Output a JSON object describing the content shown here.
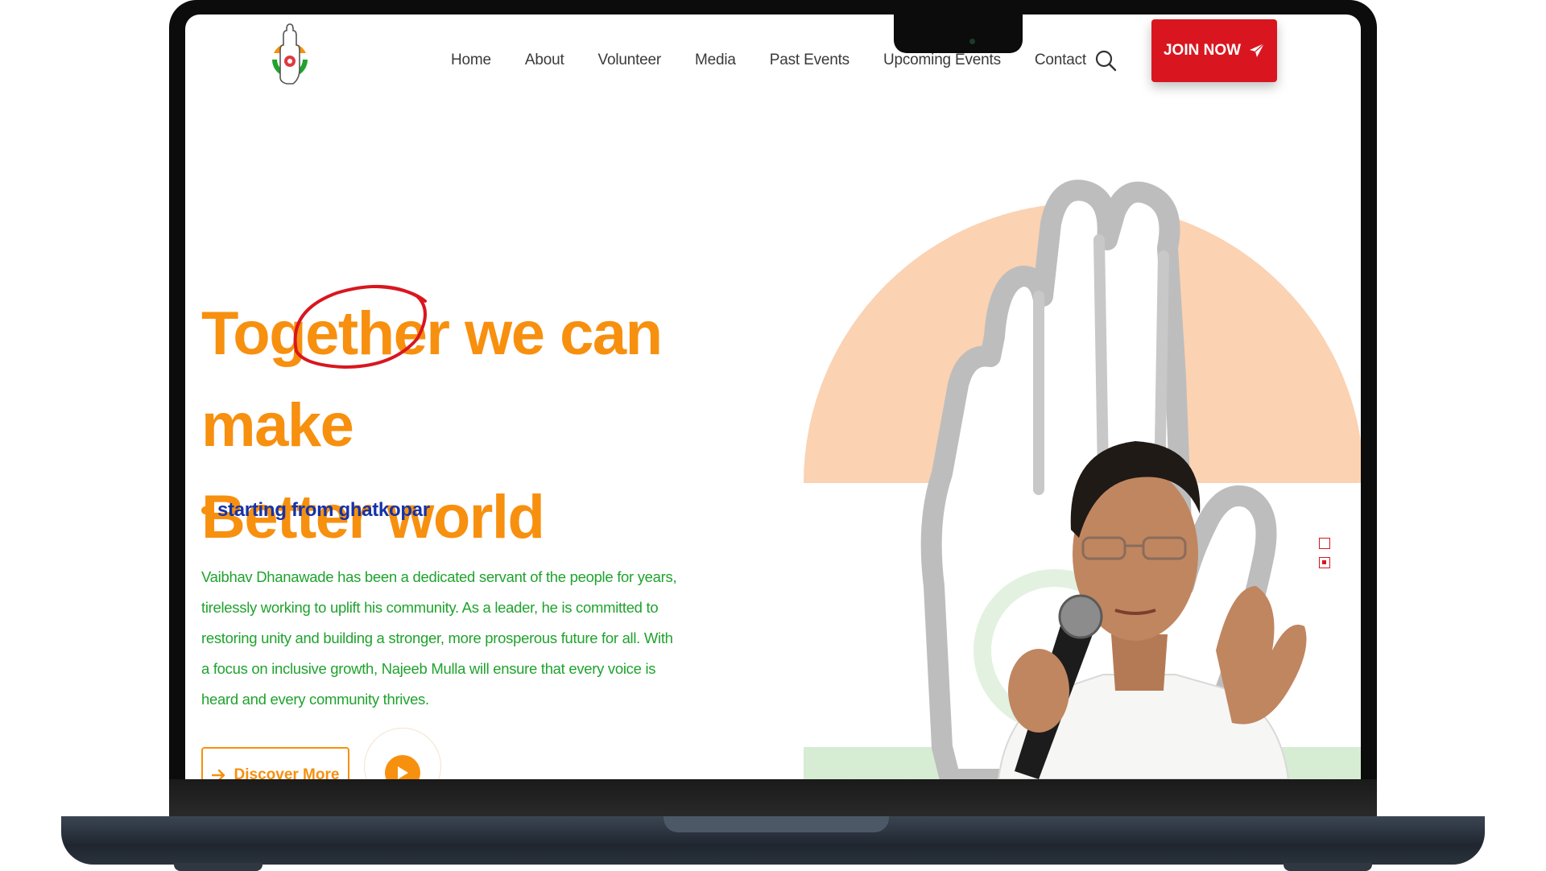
{
  "header": {
    "nav": [
      "Home",
      "About",
      "Volunteer",
      "Media",
      "Past Events",
      "Upcoming Events",
      "Contact"
    ],
    "join_label": "JOIN NOW",
    "icons": {
      "search": "search-icon",
      "join": "paper-plane-icon",
      "logo": "congress-hand-logo"
    }
  },
  "hero": {
    "title_line1": "Together we can make",
    "title_line2": "Better world",
    "tagline": "starting from ghatkopar",
    "description": "Vaibhav Dhanawade has been a dedicated servant of the people for years, tirelessly working to uplift his community. As a leader, he is committed to restoring unity and building a stronger, more prosperous future for all. With a focus on inclusive growth, Najeeb Mulla will ensure that every voice is heard and every community thrives.",
    "discover_label": "Discover More",
    "icons": {
      "discover": "arrow-right-icon",
      "play": "play-icon"
    }
  },
  "slider": {
    "count": 2,
    "active_index": 1
  },
  "colors": {
    "saffron": "#f7900f",
    "red": "#d9161f",
    "blue": "#1533a8",
    "green": "#1fa32d",
    "nav_text": "#3a3a3a"
  }
}
